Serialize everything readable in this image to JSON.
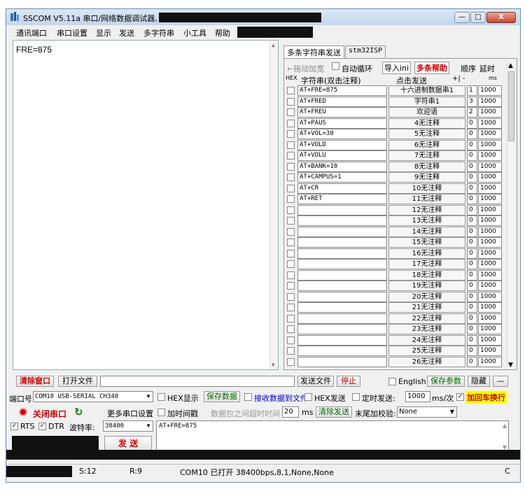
{
  "window": {
    "title": "SSCOM V5.11a 串口/网络数据调试器,",
    "min": "—",
    "max": "□",
    "close": "X"
  },
  "menu": [
    "通讯端口",
    "串口设置",
    "显示",
    "发送",
    "多字符串",
    "小工具",
    "帮助"
  ],
  "receive": {
    "text": "FRE=875"
  },
  "multi": {
    "tabs": [
      "多条字符串发送",
      "stm32ISP"
    ],
    "toolbar": {
      "drag": "←拖动加宽",
      "loop": "自动循环",
      "import": "导入ini",
      "help": "多条帮助",
      "order": "顺序",
      "delay": "延时"
    },
    "header": {
      "hex": "HEX",
      "str": "字符串(双击注释)",
      "send": "点击发送",
      "pm": "+| -",
      "ms": "ms"
    },
    "rows": [
      {
        "cmd": "AT+FRE=875",
        "label": "十六进制数据串1",
        "order": "1",
        "delay": "1000"
      },
      {
        "cmd": "AT+FRED",
        "label": "字符串1",
        "order": "3",
        "delay": "1000"
      },
      {
        "cmd": "AT+FREU",
        "label": "欢迎语",
        "order": "2",
        "delay": "1000"
      },
      {
        "cmd": "AT+PAUS",
        "label": "4无注释",
        "order": "0",
        "delay": "1000"
      },
      {
        "cmd": "AT+VOL=30",
        "label": "5无注释",
        "order": "0",
        "delay": "1000"
      },
      {
        "cmd": "AT+VOLD",
        "label": "6无注释",
        "order": "0",
        "delay": "1000"
      },
      {
        "cmd": "AT+VOLU",
        "label": "7无注释",
        "order": "0",
        "delay": "1000"
      },
      {
        "cmd": "AT+BANK=10",
        "label": "8无注释",
        "order": "0",
        "delay": "1000"
      },
      {
        "cmd": "AT+CAMPUS=1",
        "label": "9无注释",
        "order": "0",
        "delay": "1000"
      },
      {
        "cmd": "AT+CR",
        "label": "10无注释",
        "order": "0",
        "delay": "1000"
      },
      {
        "cmd": "AT+RET",
        "label": "11无注释",
        "order": "0",
        "delay": "1000"
      },
      {
        "cmd": "",
        "label": "12无注释",
        "order": "0",
        "delay": "1000"
      },
      {
        "cmd": "",
        "label": "13无注释",
        "order": "0",
        "delay": "1000"
      },
      {
        "cmd": "",
        "label": "14无注释",
        "order": "0",
        "delay": "1000"
      },
      {
        "cmd": "",
        "label": "15无注释",
        "order": "0",
        "delay": "1000"
      },
      {
        "cmd": "",
        "label": "16无注释",
        "order": "0",
        "delay": "1000"
      },
      {
        "cmd": "",
        "label": "17无注释",
        "order": "0",
        "delay": "1000"
      },
      {
        "cmd": "",
        "label": "18无注释",
        "order": "0",
        "delay": "1000"
      },
      {
        "cmd": "",
        "label": "19无注释",
        "order": "0",
        "delay": "1000"
      },
      {
        "cmd": "",
        "label": "20无注释",
        "order": "0",
        "delay": "1000"
      },
      {
        "cmd": "",
        "label": "21无注释",
        "order": "0",
        "delay": "1000"
      },
      {
        "cmd": "",
        "label": "22无注释",
        "order": "0",
        "delay": "1000"
      },
      {
        "cmd": "",
        "label": "23无注释",
        "order": "0",
        "delay": "1000"
      },
      {
        "cmd": "",
        "label": "24无注释",
        "order": "0",
        "delay": "1000"
      },
      {
        "cmd": "",
        "label": "25无注释",
        "order": "0",
        "delay": "1000"
      },
      {
        "cmd": "",
        "label": "26无注释",
        "order": "0",
        "delay": "1000"
      }
    ]
  },
  "ctlbar": {
    "clear": "清除窗口",
    "openfile": "打开文件",
    "sendfile": "发送文件",
    "stop": "停止",
    "english": "English",
    "saveparam": "保存参数",
    "hide": "隐藏",
    "minus": "—"
  },
  "port": {
    "label": "端口号",
    "value": "COM10 USB-SERIAL CH340",
    "close": "关闭串口",
    "more": "更多串口设置",
    "rts": "RTS",
    "dtr": "DTR",
    "baud_label": "波特率:",
    "baud": "38400"
  },
  "opts": {
    "hexshow": "HEX显示",
    "savedata": "保存数据",
    "recvfile": "接收数据到文件",
    "hexsend": "HEX发送",
    "timed": "定时发送:",
    "interval": "1000",
    "unit": "ms/次",
    "crlf": "加回车换行",
    "timestamp": "加时间戳",
    "timeout": "数据包之间超时时间",
    "timeout_val": "20",
    "ms": "ms",
    "clearsend": "清除发送",
    "checksum": "末尾加校验:",
    "checksum_val": "None"
  },
  "send": {
    "text": "AT+FRE=875",
    "button": "发 送"
  },
  "status": {
    "s": "S:12",
    "r": "R:9",
    "info": "COM10 已打开  38400bps,8,1,None,None",
    "right": "C"
  }
}
